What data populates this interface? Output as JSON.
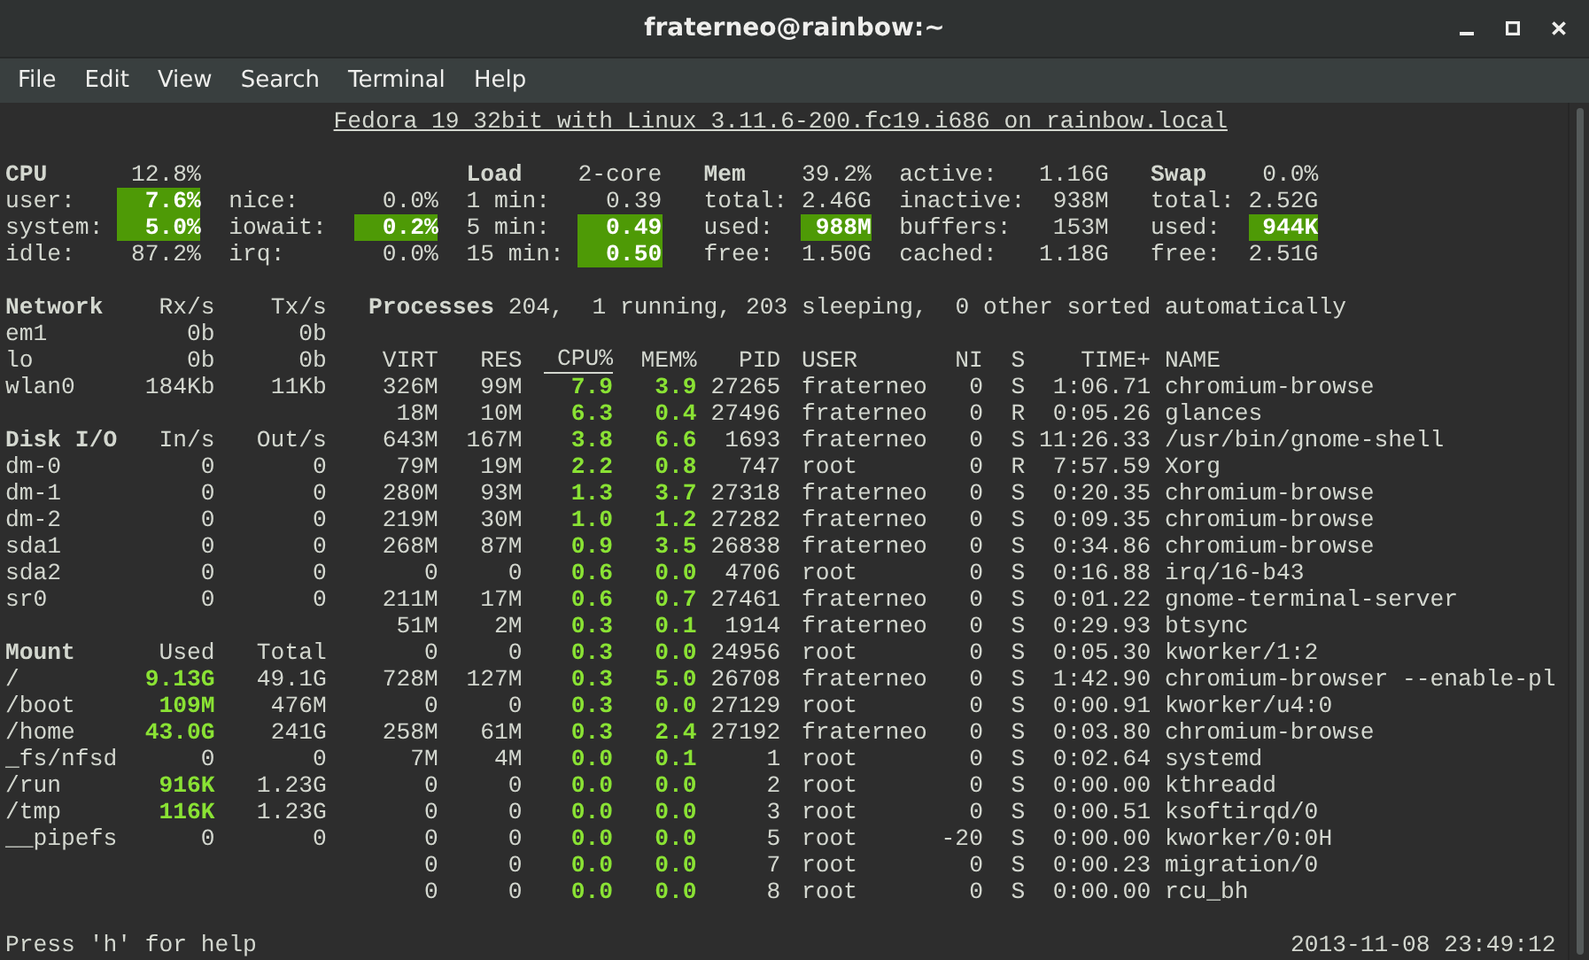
{
  "window": {
    "title": "fraterneo@rainbow:~"
  },
  "menu": [
    "File",
    "Edit",
    "View",
    "Search",
    "Terminal",
    "Help"
  ],
  "system_line": "Fedora 19 32bit with Linux 3.11.6-200.fc19.i686 on rainbow.local",
  "stats": [
    {
      "heading": {
        "label": "CPU",
        "value": "12.8%"
      },
      "rows": [
        {
          "label": "user:",
          "value": "7.6%",
          "highlighted": true
        },
        {
          "label": "system:",
          "value": "5.0%",
          "highlighted": true
        },
        {
          "label": "idle:",
          "value": "87.2%",
          "highlighted": false
        }
      ]
    },
    {
      "rows": [
        {
          "label": "nice:",
          "value": "0.0%",
          "highlighted": false
        },
        {
          "label": "iowait:",
          "value": "0.2%",
          "highlighted": true
        },
        {
          "label": "irq:",
          "value": "0.0%",
          "highlighted": false
        }
      ]
    },
    {
      "heading": {
        "label": "Load",
        "value": "2-core"
      },
      "rows": [
        {
          "label": "1 min:",
          "value": "0.39",
          "highlighted": false
        },
        {
          "label": "5 min:",
          "value": "0.49",
          "highlighted": true
        },
        {
          "label": "15 min:",
          "value": "0.50",
          "highlighted": true
        }
      ]
    },
    {
      "heading": {
        "label": "Mem",
        "value": "39.2%"
      },
      "rows": [
        {
          "label": "total:",
          "value": "2.46G",
          "highlighted": false
        },
        {
          "label": "used:",
          "value": "988M",
          "highlighted": true
        },
        {
          "label": "free:",
          "value": "1.50G",
          "highlighted": false
        }
      ]
    },
    {
      "rows": [
        {
          "label": "active:",
          "value": "1.16G",
          "highlighted": false
        },
        {
          "label": "inactive:",
          "value": "938M",
          "highlighted": false
        },
        {
          "label": "buffers:",
          "value": "153M",
          "highlighted": false
        },
        {
          "label": "cached:",
          "value": "1.18G",
          "highlighted": false
        }
      ]
    },
    {
      "heading": {
        "label": "Swap",
        "value": "0.0%"
      },
      "rows": [
        {
          "label": "total:",
          "value": "2.52G",
          "highlighted": false
        },
        {
          "label": "used:",
          "value": "944K",
          "highlighted": true
        },
        {
          "label": "free:",
          "value": "2.51G",
          "highlighted": false
        }
      ]
    }
  ],
  "sections": [
    {
      "columns": [
        "Network",
        "Rx/s",
        "Tx/s"
      ],
      "rows": [
        {
          "cells": [
            "em1",
            "0b",
            "0b"
          ],
          "used_colored": false
        },
        {
          "cells": [
            "lo",
            "0b",
            "0b"
          ],
          "used_colored": false
        },
        {
          "cells": [
            "wlan0",
            "184Kb",
            "11Kb"
          ],
          "used_colored": false
        }
      ]
    },
    {
      "columns": [
        "Disk I/O",
        "In/s",
        "Out/s"
      ],
      "rows": [
        {
          "cells": [
            "dm-0",
            "0",
            "0"
          ],
          "used_colored": false
        },
        {
          "cells": [
            "dm-1",
            "0",
            "0"
          ],
          "used_colored": false
        },
        {
          "cells": [
            "dm-2",
            "0",
            "0"
          ],
          "used_colored": false
        },
        {
          "cells": [
            "sda1",
            "0",
            "0"
          ],
          "used_colored": false
        },
        {
          "cells": [
            "sda2",
            "0",
            "0"
          ],
          "used_colored": false
        },
        {
          "cells": [
            "sr0",
            "0",
            "0"
          ],
          "used_colored": false
        }
      ]
    },
    {
      "columns": [
        "Mount",
        "Used",
        "Total"
      ],
      "rows": [
        {
          "cells": [
            "/",
            "9.13G",
            "49.1G"
          ],
          "used_colored": true
        },
        {
          "cells": [
            "/boot",
            "109M",
            "476M"
          ],
          "used_colored": true
        },
        {
          "cells": [
            "/home",
            "43.0G",
            "241G"
          ],
          "used_colored": true
        },
        {
          "cells": [
            "_fs/nfsd",
            "0",
            "0"
          ],
          "used_colored": false
        },
        {
          "cells": [
            "/run",
            "916K",
            "1.23G"
          ],
          "used_colored": true
        },
        {
          "cells": [
            "/tmp",
            "116K",
            "1.23G"
          ],
          "used_colored": true
        },
        {
          "cells": [
            "__pipefs",
            "0",
            "0"
          ],
          "used_colored": false
        }
      ]
    }
  ],
  "processes": {
    "summary": "**Processes** 204,  1 running, 203 sleeping,  0 other sorted automatically",
    "columns": [
      {
        "label": "VIRT",
        "colored": false,
        "sorted": false
      },
      {
        "label": "RES",
        "colored": false,
        "sorted": false
      },
      {
        "label": "CPU%",
        "colored": true,
        "sorted": true
      },
      {
        "label": "MEM%",
        "colored": true,
        "sorted": false
      },
      {
        "label": "PID",
        "colored": false,
        "sorted": false
      },
      {
        "label": "USER",
        "colored": false,
        "sorted": false
      },
      {
        "label": "NI",
        "colored": false,
        "sorted": false
      },
      {
        "label": "S",
        "colored": false,
        "sorted": false
      },
      {
        "label": "TIME+",
        "colored": false,
        "sorted": false
      },
      {
        "label": "NAME",
        "colored": false,
        "sorted": false
      }
    ],
    "rows": [
      [
        "326M",
        "99M",
        "7.9",
        "3.9",
        "27265",
        "fraterneo",
        "0",
        "S",
        "1:06.71",
        "chromium-browse"
      ],
      [
        "18M",
        "10M",
        "6.3",
        "0.4",
        "27496",
        "fraterneo",
        "0",
        "R",
        "0:05.26",
        "glances"
      ],
      [
        "643M",
        "167M",
        "3.8",
        "6.6",
        "1693",
        "fraterneo",
        "0",
        "S",
        "11:26.33",
        "/usr/bin/gnome-shell"
      ],
      [
        "79M",
        "19M",
        "2.2",
        "0.8",
        "747",
        "root",
        "0",
        "R",
        "7:57.59",
        "Xorg"
      ],
      [
        "280M",
        "93M",
        "1.3",
        "3.7",
        "27318",
        "fraterneo",
        "0",
        "S",
        "0:20.35",
        "chromium-browse"
      ],
      [
        "219M",
        "30M",
        "1.0",
        "1.2",
        "27282",
        "fraterneo",
        "0",
        "S",
        "0:09.35",
        "chromium-browse"
      ],
      [
        "268M",
        "87M",
        "0.9",
        "3.5",
        "26838",
        "fraterneo",
        "0",
        "S",
        "0:34.86",
        "chromium-browse"
      ],
      [
        "0",
        "0",
        "0.6",
        "0.0",
        "4706",
        "root",
        "0",
        "S",
        "0:16.88",
        "irq/16-b43"
      ],
      [
        "211M",
        "17M",
        "0.6",
        "0.7",
        "27461",
        "fraterneo",
        "0",
        "S",
        "0:01.22",
        "gnome-terminal-server"
      ],
      [
        "51M",
        "2M",
        "0.3",
        "0.1",
        "1914",
        "fraterneo",
        "0",
        "S",
        "0:29.93",
        "btsync"
      ],
      [
        "0",
        "0",
        "0.3",
        "0.0",
        "24956",
        "root",
        "0",
        "S",
        "0:05.30",
        "kworker/1:2"
      ],
      [
        "728M",
        "127M",
        "0.3",
        "5.0",
        "26708",
        "fraterneo",
        "0",
        "S",
        "1:42.90",
        "chromium-browser --enable-pl"
      ],
      [
        "0",
        "0",
        "0.3",
        "0.0",
        "27129",
        "root",
        "0",
        "S",
        "0:00.91",
        "kworker/u4:0"
      ],
      [
        "258M",
        "61M",
        "0.3",
        "2.4",
        "27192",
        "fraterneo",
        "0",
        "S",
        "0:03.80",
        "chromium-browse"
      ],
      [
        "7M",
        "4M",
        "0.0",
        "0.1",
        "1",
        "root",
        "0",
        "S",
        "0:02.64",
        "systemd"
      ],
      [
        "0",
        "0",
        "0.0",
        "0.0",
        "2",
        "root",
        "0",
        "S",
        "0:00.00",
        "kthreadd"
      ],
      [
        "0",
        "0",
        "0.0",
        "0.0",
        "3",
        "root",
        "0",
        "S",
        "0:00.51",
        "ksoftirqd/0"
      ],
      [
        "0",
        "0",
        "0.0",
        "0.0",
        "5",
        "root",
        "-20",
        "S",
        "0:00.00",
        "kworker/0:0H"
      ],
      [
        "0",
        "0",
        "0.0",
        "0.0",
        "7",
        "root",
        "0",
        "S",
        "0:00.23",
        "migration/0"
      ],
      [
        "0",
        "0",
        "0.0",
        "0.0",
        "8",
        "root",
        "0",
        "S",
        "0:00.00",
        "rcu_bh"
      ]
    ]
  },
  "footer": {
    "hint": "Press 'h' for help",
    "timestamp": "2013-11-08 23:49:12"
  }
}
